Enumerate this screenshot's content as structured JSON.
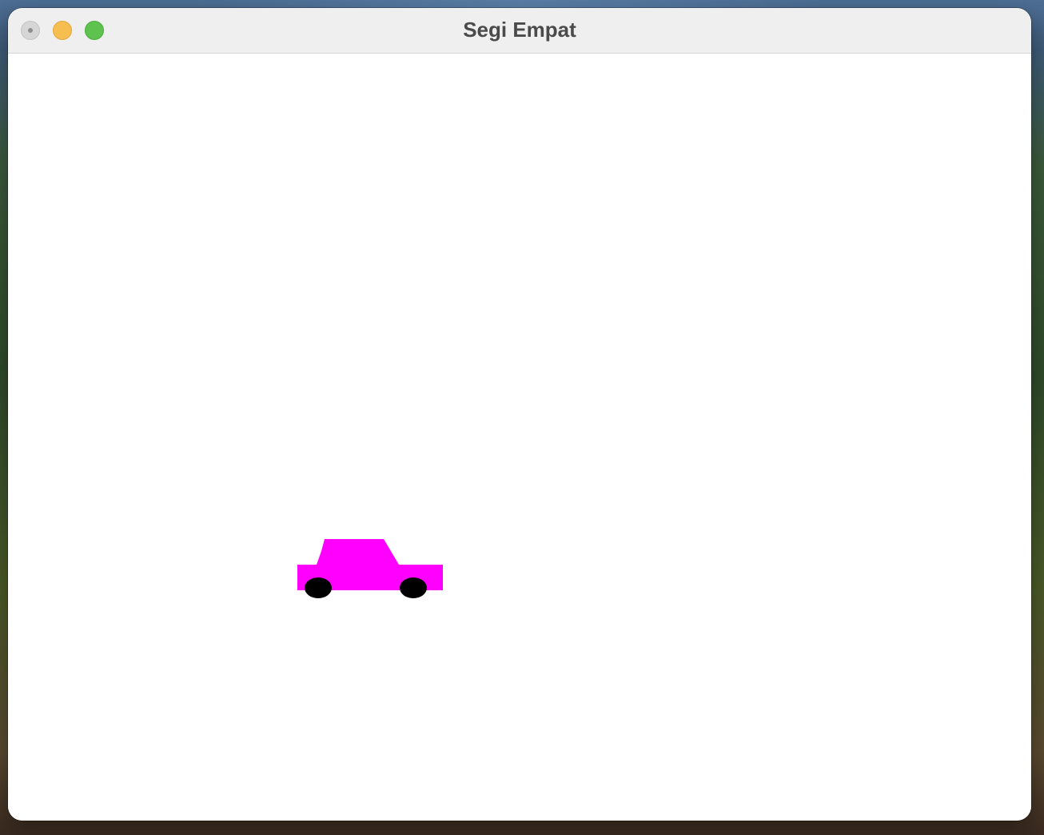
{
  "window": {
    "title": "Segi Empat",
    "controls": {
      "close": {
        "icon": "close-icon",
        "color": "#d6d6d6"
      },
      "minimize": {
        "icon": "minimize-icon",
        "color": "#f6bd4f"
      },
      "maximize": {
        "icon": "maximize-icon",
        "color": "#5ec24e"
      }
    }
  },
  "canvas": {
    "background": "#ffffff",
    "drawing": {
      "object": "car",
      "body_color": "#ff00ff",
      "wheel_color": "#000000",
      "wheel_count": 2
    }
  }
}
